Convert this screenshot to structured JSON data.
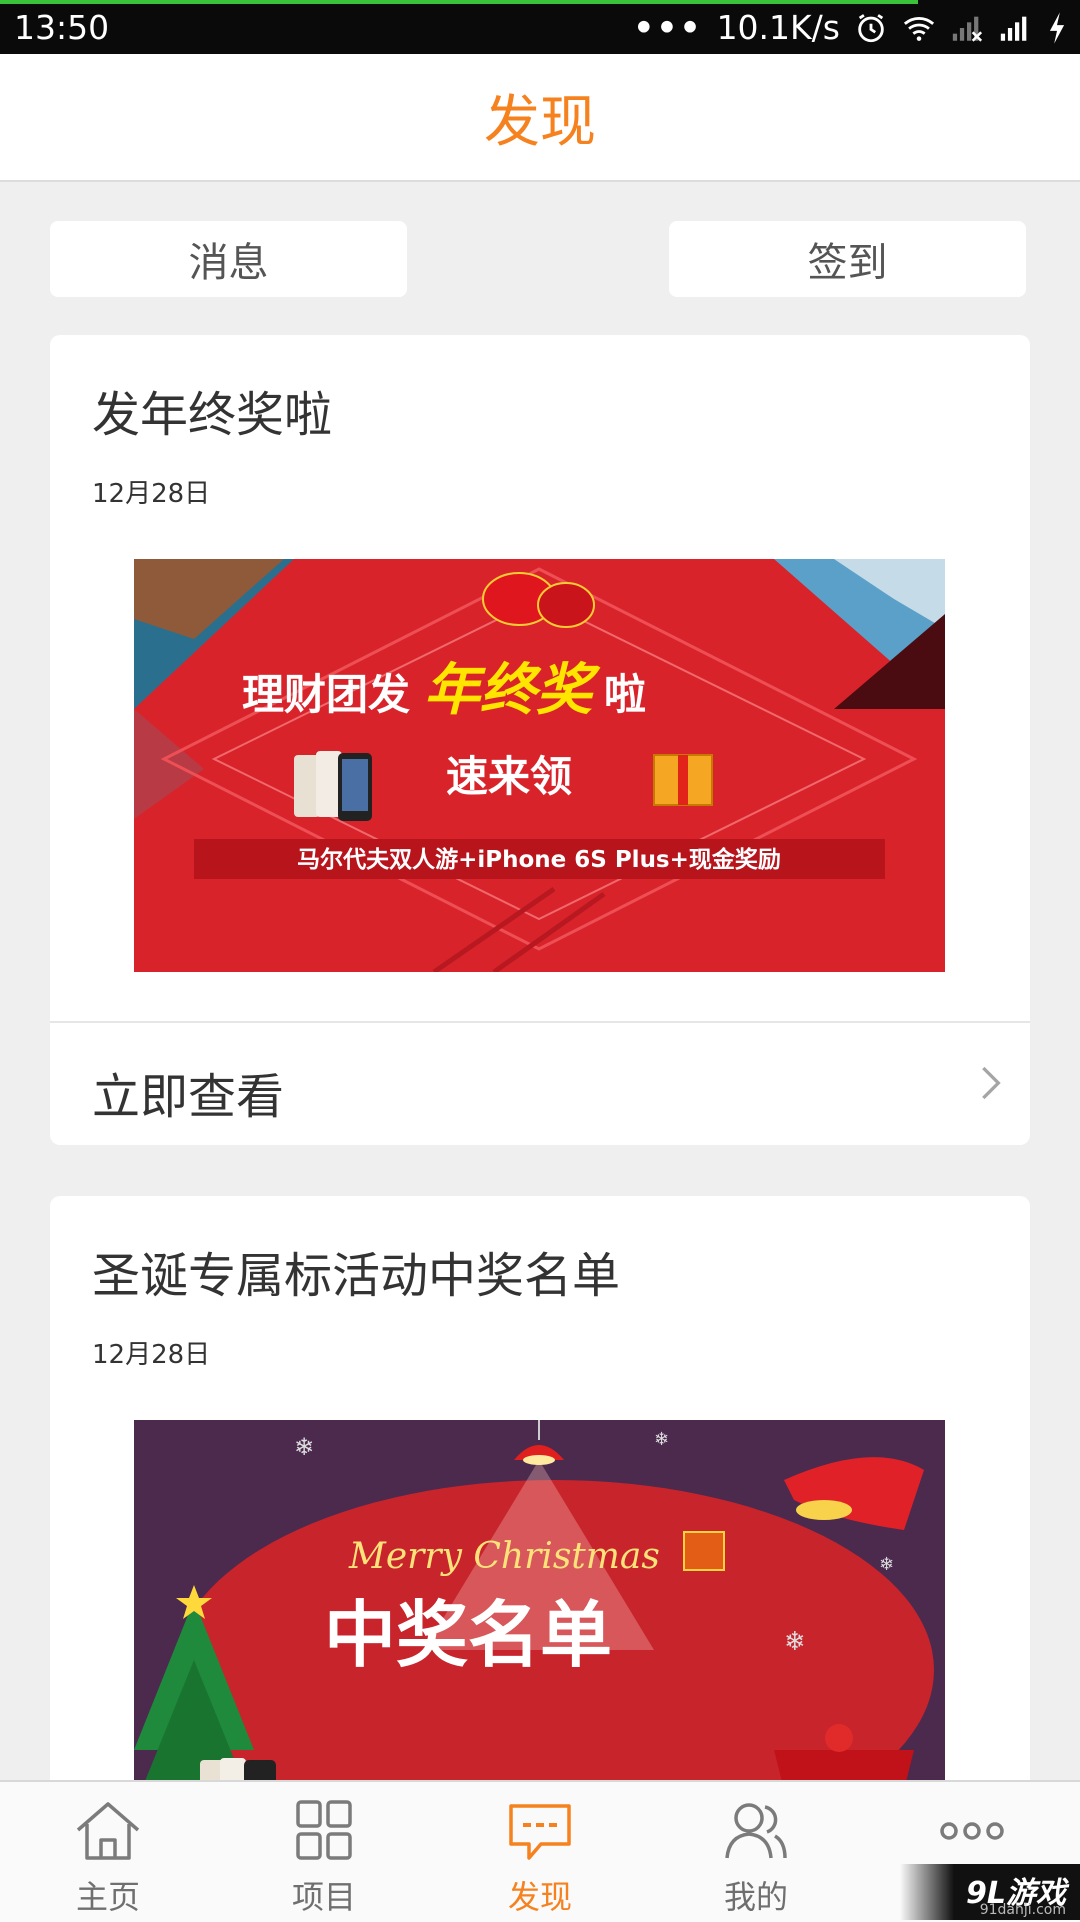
{
  "status_bar": {
    "time": "13:50",
    "net_speed": "10.1K/s",
    "progress": 0.85
  },
  "header": {
    "title": "发现"
  },
  "actions": {
    "message_label": "消息",
    "signin_label": "签到"
  },
  "posts": [
    {
      "title": "发年终奖啦",
      "date": "12月28日",
      "banner": {
        "line1a": "理财团发",
        "line1b": "年终奖",
        "line1c": "啦",
        "line2": "速来领",
        "line3": "马尔代夫双人游+iPhone 6S Plus+现金奖励"
      },
      "view_label": "立即查看"
    },
    {
      "title": "圣诞专属标活动中奖名单",
      "date": "12月28日",
      "banner": {
        "line1": "Merry Christmas",
        "line2": "中奖名单"
      }
    }
  ],
  "tabs": [
    {
      "label": "主页",
      "icon": "home-icon"
    },
    {
      "label": "项目",
      "icon": "grid-icon"
    },
    {
      "label": "发现",
      "icon": "chat-icon",
      "active": true
    },
    {
      "label": "我的",
      "icon": "users-icon"
    },
    {
      "label": "",
      "icon": "more-icon"
    }
  ],
  "watermark": {
    "text": "9L游戏",
    "site": "91danji.com"
  },
  "colors": {
    "accent": "#f5821f",
    "background": "#efefef"
  }
}
